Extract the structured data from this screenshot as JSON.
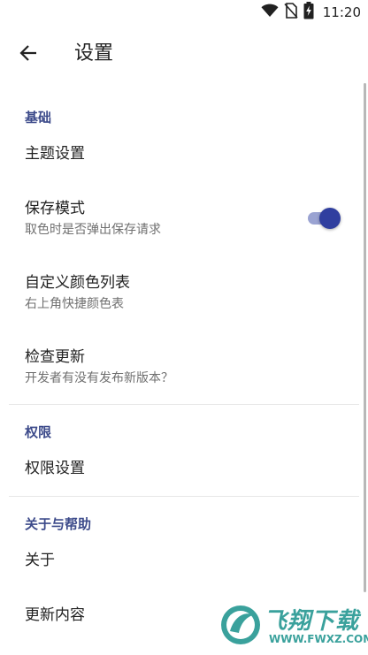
{
  "status_bar": {
    "time": "11:20",
    "icons": [
      "wifi-icon",
      "no-sim-icon",
      "battery-charging-icon"
    ]
  },
  "app_bar": {
    "back_icon": "arrow-left-icon",
    "title": "设置"
  },
  "sections": {
    "basic": {
      "header": "基础",
      "theme": {
        "title": "主题设置"
      },
      "save_mode": {
        "title": "保存模式",
        "summary": "取色时是否弹出保存请求",
        "enabled": true
      },
      "custom_colors": {
        "title": "自定义颜色列表",
        "summary": "右上角快捷颜色表"
      },
      "check_update": {
        "title": "检查更新",
        "summary": "开发者有没有发布新版本？"
      }
    },
    "permissions": {
      "header": "权限",
      "permission_settings": {
        "title": "权限设置"
      }
    },
    "about": {
      "header": "关于与帮助",
      "about_item": {
        "title": "关于"
      },
      "changelog": {
        "title": "更新内容"
      }
    }
  },
  "watermark": {
    "logo_text": "飞翔下载",
    "url": "WWW.FWXZ.COM"
  },
  "colors": {
    "accent": "#303f9f",
    "category_text": "#3c4a8a",
    "toggle_track": "#9aa3d2",
    "watermark": "#2a9a94"
  }
}
